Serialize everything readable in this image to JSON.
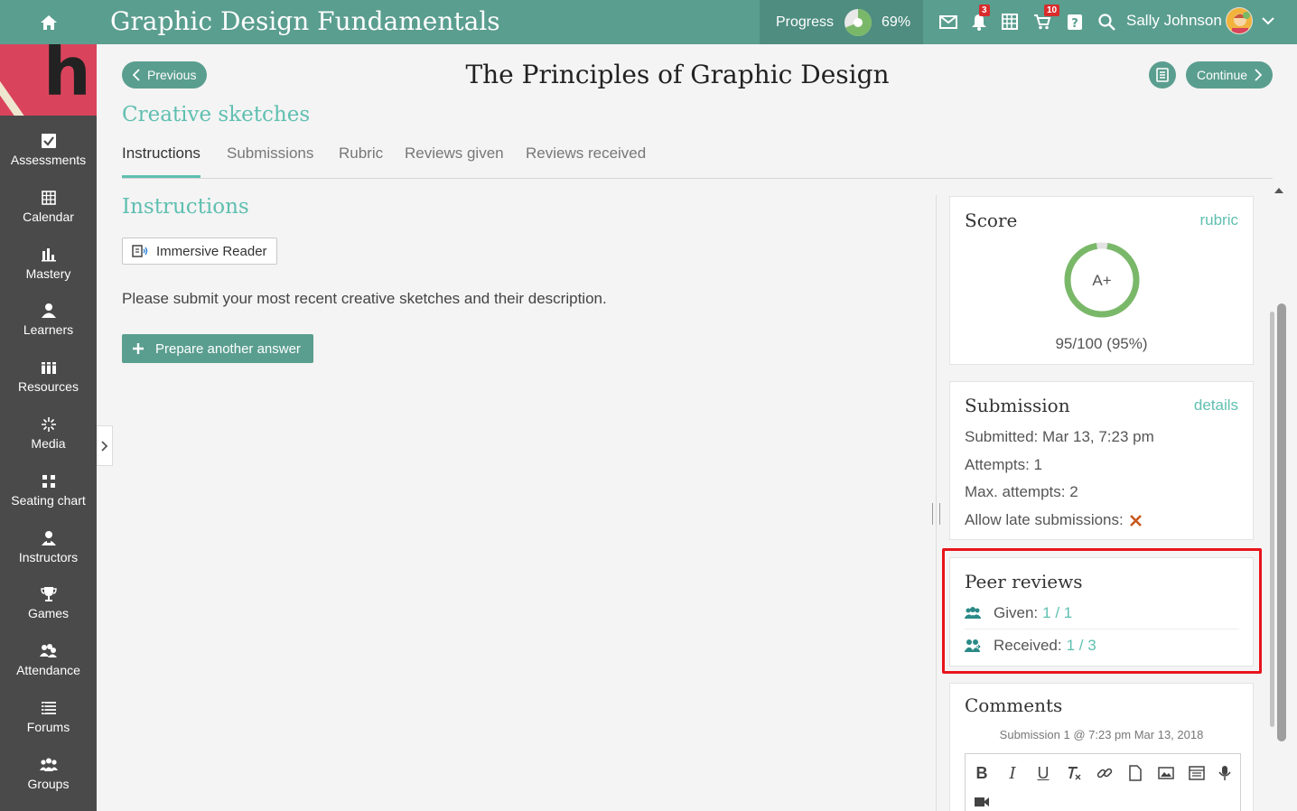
{
  "app": {
    "course_title": "Graphic Design Fundamentals",
    "progress_label": "Progress",
    "progress_value": "69%",
    "progress_fraction": 0.69,
    "notifications_count": "3",
    "cart_count": "10",
    "user_name": "Sally Johnson"
  },
  "sidebar": {
    "items": [
      {
        "label": "Assessments",
        "icon": "checkbox-icon"
      },
      {
        "label": "Calendar",
        "icon": "calendar-icon"
      },
      {
        "label": "Mastery",
        "icon": "bar-chart-icon"
      },
      {
        "label": "Learners",
        "icon": "person-icon"
      },
      {
        "label": "Resources",
        "icon": "books-icon"
      },
      {
        "label": "Media",
        "icon": "sparkle-icon"
      },
      {
        "label": "Seating chart",
        "icon": "seats-icon"
      },
      {
        "label": "Instructors",
        "icon": "instructor-icon"
      },
      {
        "label": "Games",
        "icon": "trophy-icon"
      },
      {
        "label": "Attendance",
        "icon": "group-icon"
      },
      {
        "label": "Forums",
        "icon": "list-icon"
      },
      {
        "label": "Groups",
        "icon": "groups-icon"
      }
    ]
  },
  "header": {
    "previous_label": "Previous",
    "page_title": "The Principles of Graphic Design",
    "continue_label": "Continue",
    "assignment_title": "Creative sketches"
  },
  "tabs": [
    {
      "label": "Instructions",
      "active": true
    },
    {
      "label": "Submissions",
      "active": false
    },
    {
      "label": "Rubric",
      "active": false
    },
    {
      "label": "Reviews given",
      "active": false
    },
    {
      "label": "Reviews received",
      "active": false
    }
  ],
  "instructions": {
    "heading": "Instructions",
    "immersive_reader_label": "Immersive Reader",
    "text": "Please submit your most recent creative sketches and their description.",
    "prepare_label": "Prepare another answer"
  },
  "score": {
    "title": "Score",
    "link": "rubric",
    "grade": "A+",
    "points": "95/100 (95%)",
    "fraction": 0.95
  },
  "submission": {
    "title": "Submission",
    "link": "details",
    "submitted": "Submitted: Mar 13, 7:23 pm",
    "attempts": "Attempts: 1",
    "max_attempts": "Max. attempts: 2",
    "allow_late": "Allow late submissions:"
  },
  "peer_reviews": {
    "title": "Peer reviews",
    "given_label": "Given:",
    "given_value": "1 / 1",
    "received_label": "Received:",
    "received_value": "1 / 3"
  },
  "comments": {
    "title": "Comments",
    "subtitle": "Submission 1 @ 7:23 pm Mar 13, 2018"
  },
  "colors": {
    "topbar": "#5a9e8f",
    "accent": "#5fbfb0",
    "sidebar": "#4a4a4a",
    "highlight": "#e8141c",
    "score_ring": "#7ab869"
  }
}
